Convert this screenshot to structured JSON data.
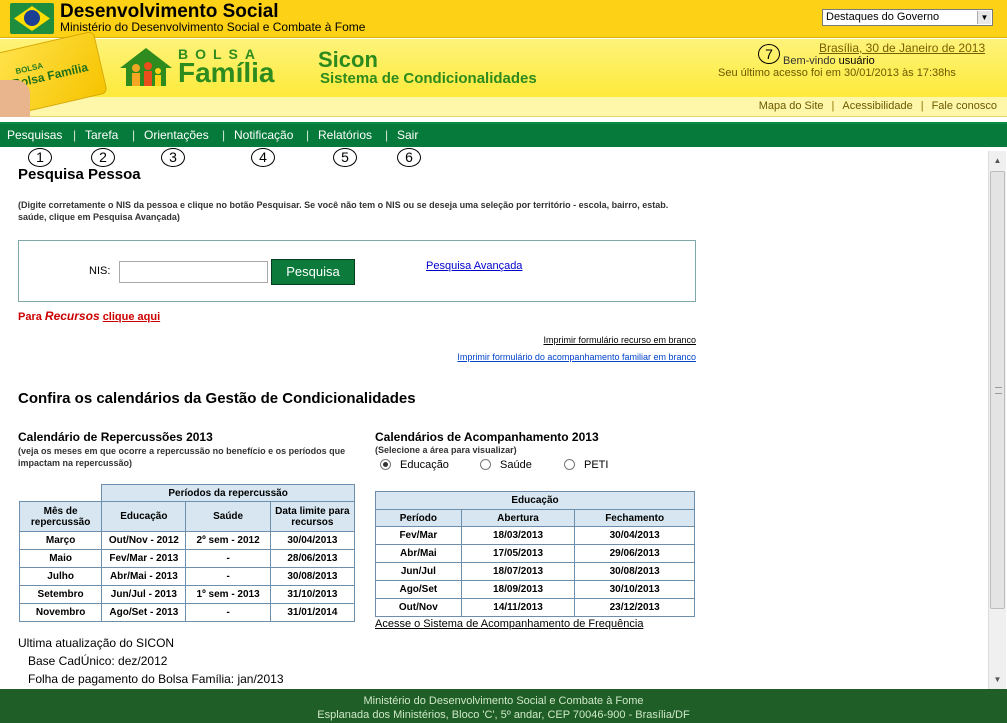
{
  "header": {
    "ministry_title": "Desenvolvimento Social",
    "ministry_subtitle": "Ministério do Desenvolvimento Social e Combate à Fome",
    "destaques_select": "Destaques do Governo"
  },
  "banner": {
    "card_small": "BOLSA",
    "card_text": "Bolsa Família",
    "program_bolsa": "BOLSA",
    "program_familia": "Família",
    "sicon_title": "Sicon",
    "sicon_subtitle": "Sistema de Condicionalidades",
    "date": "Brasília, 30 de Janeiro de 2013",
    "welcome_prefix": "Bem-vindo",
    "welcome_user": "usuário",
    "last_access": "Seu último acesso foi em 30/01/2013 às 17:38hs",
    "annotation_7": "7"
  },
  "util_links": [
    "Mapa do Site",
    "Acessibilidade",
    "Fale conosco"
  ],
  "nav": {
    "items": [
      "Pesquisas",
      "Tarefa",
      "Orientações",
      "Notificação",
      "Relatórios",
      "Sair"
    ],
    "annotations": [
      "1",
      "2",
      "3",
      "4",
      "5",
      "6"
    ]
  },
  "search": {
    "title": "Pesquisa Pessoa",
    "intro": "(Digite corretamente o NIS da pessoa e clique no botão Pesquisar. Se você não tem o NIS ou se deseja uma seleção por território - escola, bairro, estab. saúde, clique em Pesquisa Avançada)",
    "nis_label": "NIS:",
    "nis_value": "",
    "button": "Pesquisa",
    "advanced_link": "Pesquisa Avançada",
    "recursos_prefix": "Para",
    "recursos_word": "Recursos",
    "recursos_link": "clique aqui",
    "print_recurso": "Imprimir formulário recurso em branco",
    "print_acomp": "Imprimir formulário do acompanhamento familiar em branco"
  },
  "calendars": {
    "title": "Confira os calendários da Gestão de Condicionalidades",
    "repercussoes": {
      "title": "Calendário de Repercussões 2013",
      "note": "(veja os meses em que ocorre a repercussão no benefício e os períodos que impactam na repercussão)",
      "group_header": "Períodos da repercussão",
      "headers": [
        "Mês de repercussão",
        "Educação",
        "Saúde",
        "Data limite para recursos"
      ],
      "rows": [
        [
          "Março",
          "Out/Nov - 2012",
          "2º sem - 2012",
          "30/04/2013"
        ],
        [
          "Maio",
          "Fev/Mar - 2013",
          "-",
          "28/06/2013"
        ],
        [
          "Julho",
          "Abr/Mai - 2013",
          "-",
          "30/08/2013"
        ],
        [
          "Setembro",
          "Jun/Jul - 2013",
          "1º sem - 2013",
          "31/10/2013"
        ],
        [
          "Novembro",
          "Ago/Set - 2013",
          "-",
          "31/01/2014"
        ]
      ]
    },
    "acompanhamento": {
      "title": "Calendários de Acompanhamento 2013",
      "note": "(Selecione a área para visualizar)",
      "options": [
        "Educação",
        "Saúde",
        "PETI"
      ],
      "selected": "Educação",
      "table_title": "Educação",
      "headers": [
        "Período",
        "Abertura",
        "Fechamento"
      ],
      "rows": [
        [
          "Fev/Mar",
          "18/03/2013",
          "30/04/2013"
        ],
        [
          "Abr/Mai",
          "17/05/2013",
          "29/06/2013"
        ],
        [
          "Jun/Jul",
          "18/07/2013",
          "30/08/2013"
        ],
        [
          "Ago/Set",
          "18/09/2013",
          "30/10/2013"
        ],
        [
          "Out/Nov",
          "14/11/2013",
          "23/12/2013"
        ]
      ],
      "link": "Acesse o Sistema de Acompanhamento de Frequência"
    }
  },
  "update": {
    "title": "Ultima atualização do SICON",
    "cadunico": "Base CadÚnico: dez/2012",
    "folha": "Folha de pagamento do Bolsa Família: jan/2013"
  },
  "footer": {
    "line1": "Ministério do Desenvolvimento Social e Combate à Fome",
    "line2": "Esplanada dos Ministérios, Bloco 'C', 5º andar, CEP 70046-900 - Brasília/DF"
  },
  "colors": {
    "top_bar": "#fcd116",
    "nav_green": "#067a3a",
    "button_green": "#0c7a3b",
    "footer_green": "#1f5e26",
    "title_green": "#2d8a1c",
    "table_header": "#d7e6f0",
    "recursos_red": "#cc0000"
  }
}
